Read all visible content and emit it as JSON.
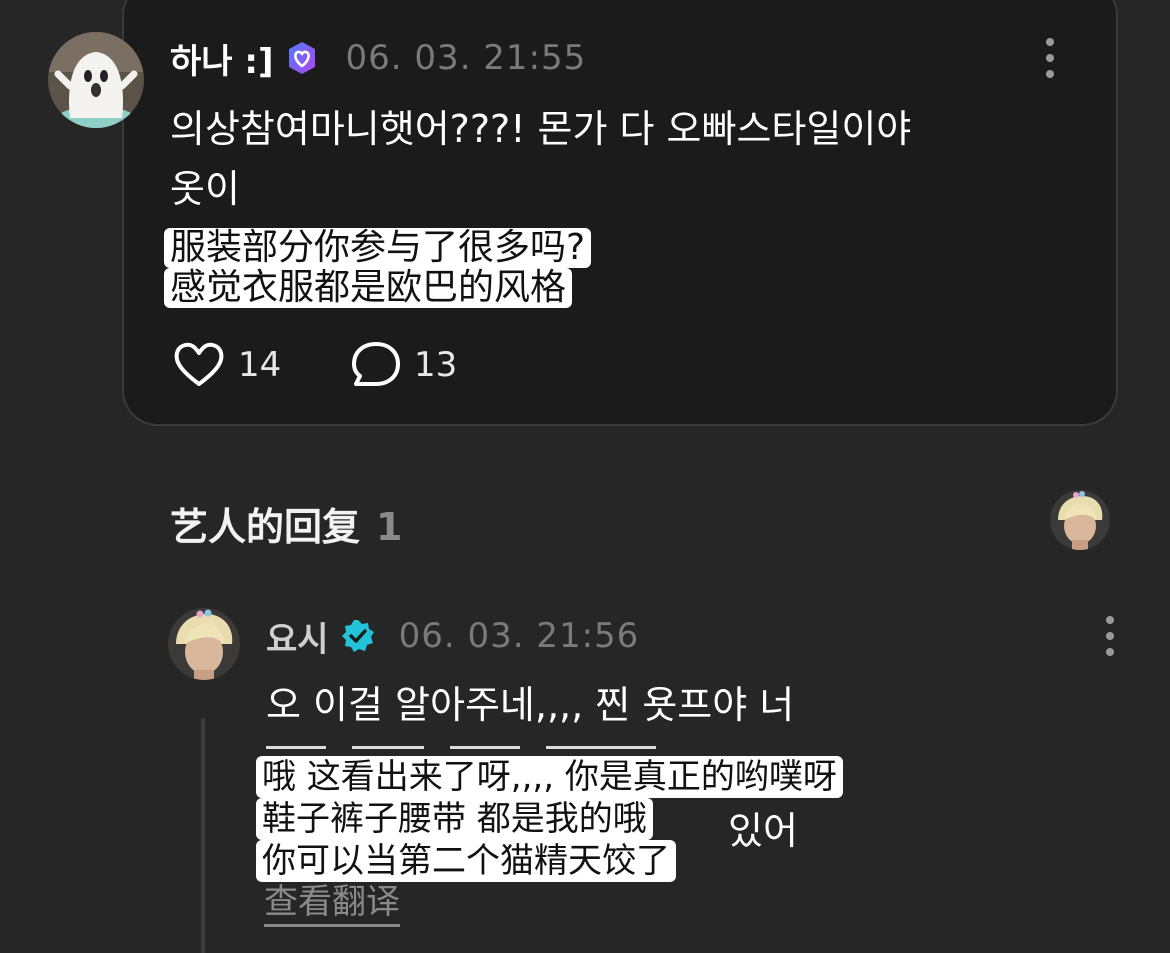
{
  "post": {
    "username": "하나 :]",
    "timestamp": "06. 03. 21:55",
    "text_line1": "의상참여마니햇어???! 몬가 다 오빠스타일이야",
    "text_line2": "옷이",
    "translation_line1": "服装部分你参与了很多吗?",
    "translation_line2": "感觉衣服都是欧巴的风格",
    "likes": "14",
    "comments": "13"
  },
  "artist_replies": {
    "title": "艺人的回复",
    "count": "1"
  },
  "reply": {
    "username": "요시",
    "timestamp": "06. 03. 21:56",
    "text_line1": "오 이걸 알아주네,,,, 찐 욧프야 너",
    "text_line2_visible_tail": "있어",
    "translation_line1": "哦 这看出来了呀,,,, 你是真正的哟噗呀",
    "translation_line2": "鞋子裤子腰带 都是我的哦",
    "translation_line3": "你可以当第二个猫精天饺了",
    "view_translation": "查看翻译"
  },
  "icons": {
    "verified_post": "purple-verified-badge-icon",
    "verified_reply": "cyan-verified-badge-icon",
    "like": "heart-outline-icon",
    "comment": "speech-bubble-outline-icon",
    "more": "vertical-ellipsis-icon"
  },
  "colors": {
    "background": "#262626",
    "card": "#1b1b1b",
    "purple_badge": "#7b5cf0",
    "cyan_badge": "#22c3d8",
    "muted_text": "#7a7a7a"
  }
}
